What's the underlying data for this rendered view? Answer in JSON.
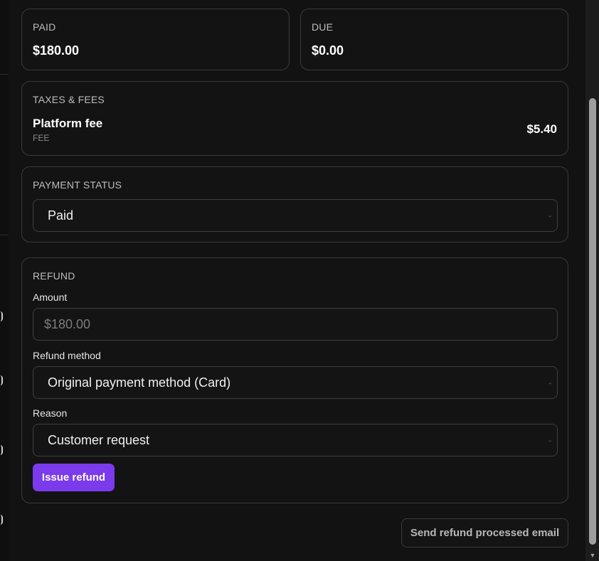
{
  "summary": {
    "paid": {
      "label": "PAID",
      "amount": "$180.00"
    },
    "due": {
      "label": "DUE",
      "amount": "$0.00"
    }
  },
  "taxes": {
    "label": "TAXES & FEES",
    "item_name": "Platform fee",
    "item_type": "FEE",
    "item_amount": "$5.40"
  },
  "payment_status": {
    "label": "PAYMENT STATUS",
    "selected": "Paid"
  },
  "refund": {
    "label": "REFUND",
    "amount_label": "Amount",
    "amount_placeholder": "$180.00",
    "method_label": "Refund method",
    "method_selected": "Original payment method (Card)",
    "reason_label": "Reason",
    "reason_selected": "Customer request",
    "issue_button": "Issue refund"
  },
  "email_button": "Send refund processed email",
  "colors": {
    "accent": "#7c3aed",
    "background": "#121212",
    "border": "#3a3a3a"
  }
}
